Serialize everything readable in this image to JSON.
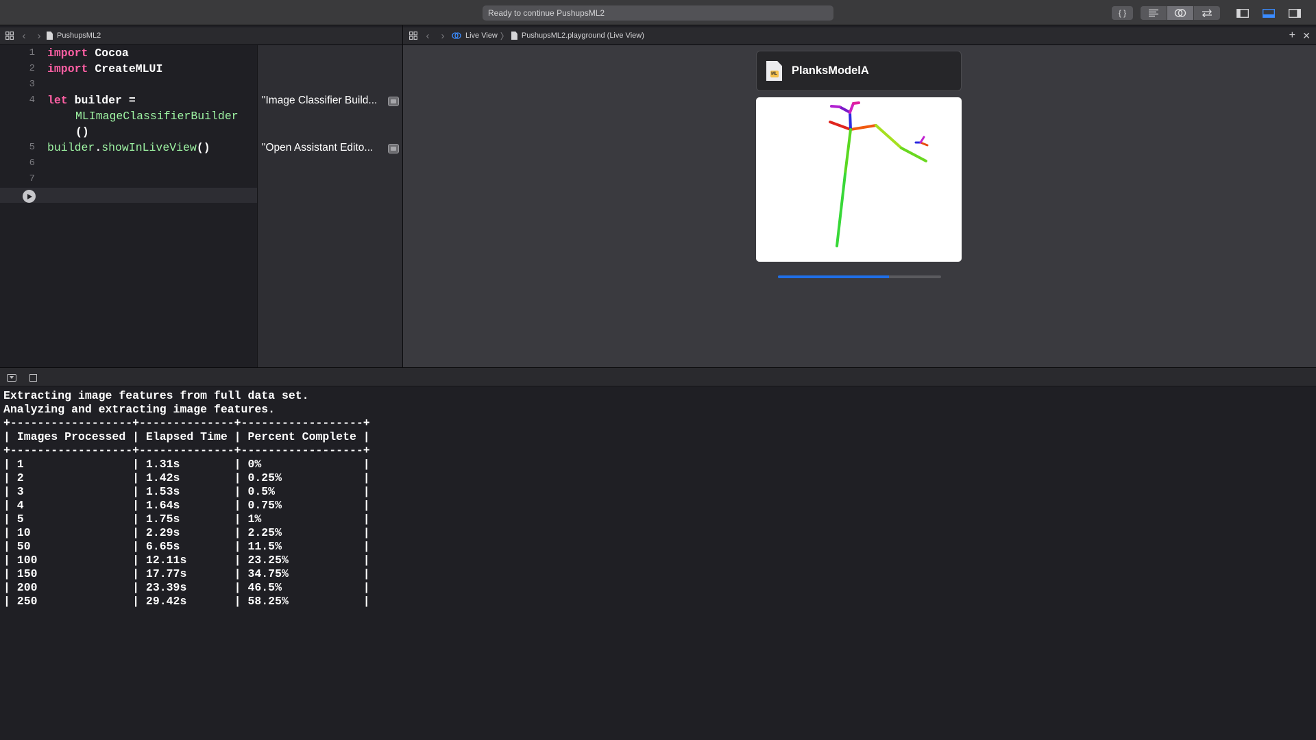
{
  "toolbar": {
    "activity_status": "Ready to continue PushupsML2",
    "buttons": [
      {
        "name": "library-button",
        "icon": "braces-icon",
        "label": "{ }"
      },
      {
        "name": "standard-editor-button",
        "icon": "lines-icon"
      },
      {
        "name": "assistant-editor-button",
        "icon": "venn-icon",
        "active": true
      },
      {
        "name": "version-editor-button",
        "icon": "arrows-icon"
      },
      {
        "name": "navigator-toggle",
        "icon": "left-panel-icon"
      },
      {
        "name": "debug-area-toggle",
        "icon": "bottom-panel-icon",
        "active": true
      },
      {
        "name": "inspector-toggle",
        "icon": "right-panel-icon"
      }
    ]
  },
  "editor_jumpbar": {
    "file": "PushupsML2"
  },
  "assistant_jumpbar": {
    "mode": "Live View",
    "file": "PushupsML2.playground (Live View)"
  },
  "editor": {
    "line_numbers": [
      "1",
      "2",
      "3",
      "4",
      "5",
      "6",
      "7"
    ]
  },
  "results": {
    "items": [
      "\"Image Classifier Build...",
      "\"Open Assistant Edito..."
    ]
  },
  "live_view": {
    "model_name": "PlanksModelA",
    "model_icon_label": "ML",
    "progress": 0.68
  },
  "console": {
    "lines": [
      "Extracting image features from full data set.",
      "Analyzing and extracting image features.",
      "+------------------+--------------+------------------+",
      "| Images Processed | Elapsed Time | Percent Complete |",
      "+------------------+--------------+------------------+",
      "| 1                | 1.31s        | 0%               |",
      "| 2                | 1.42s        | 0.25%            |",
      "| 3                | 1.53s        | 0.5%             |",
      "| 4                | 1.64s        | 0.75%            |",
      "| 5                | 1.75s        | 1%               |",
      "| 10               | 2.29s        | 2.25%            |",
      "| 50               | 6.65s        | 11.5%            |",
      "| 100              | 12.11s       | 23.25%           |",
      "| 150              | 17.77s       | 34.75%           |",
      "| 200              | 23.39s       | 46.5%            |",
      "| 250              | 29.42s       | 58.25%           |"
    ]
  },
  "colors": {
    "keyword": "#fc5fa3",
    "type": "#9ef4a3",
    "progress": "#1f6fe8"
  }
}
